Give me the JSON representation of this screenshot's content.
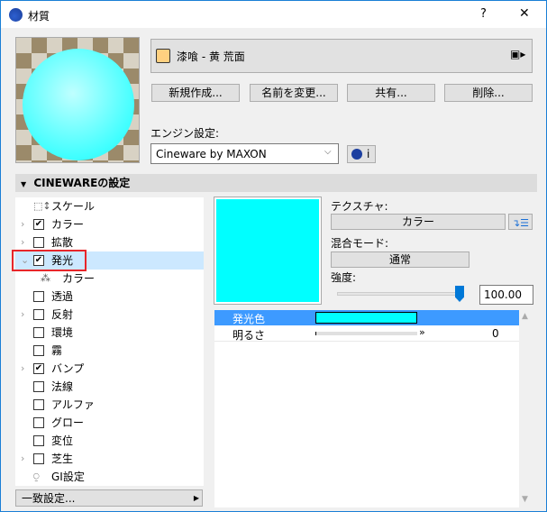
{
  "window": {
    "title": "材質",
    "help": "?",
    "close": "✕"
  },
  "material": {
    "name": "漆喰 - 黄 荒面",
    "swatch_color": "#ffd080"
  },
  "buttons": {
    "new": "新規作成...",
    "rename": "名前を変更...",
    "share": "共有...",
    "delete": "削除..."
  },
  "engine": {
    "label": "エンジン設定:",
    "value": "Cineware by MAXON",
    "info": "i"
  },
  "section": {
    "title": "CINEWAREの設定"
  },
  "tree": [
    {
      "label": "スケール",
      "check": null,
      "expand": "",
      "icon": "scale"
    },
    {
      "label": "カラー",
      "check": true,
      "expand": "›"
    },
    {
      "label": "拡散",
      "check": false,
      "expand": "›"
    },
    {
      "label": "発光",
      "check": true,
      "expand": "⌄",
      "selected": true
    },
    {
      "label": "カラー",
      "check": null,
      "expand": "",
      "icon": "channel",
      "child": true
    },
    {
      "label": "透過",
      "check": false,
      "expand": ""
    },
    {
      "label": "反射",
      "check": false,
      "expand": "›"
    },
    {
      "label": "環境",
      "check": false,
      "expand": ""
    },
    {
      "label": "霧",
      "check": false,
      "expand": ""
    },
    {
      "label": "バンプ",
      "check": true,
      "expand": "›"
    },
    {
      "label": "法線",
      "check": false,
      "expand": ""
    },
    {
      "label": "アルファ",
      "check": false,
      "expand": ""
    },
    {
      "label": "グロー",
      "check": false,
      "expand": ""
    },
    {
      "label": "変位",
      "check": false,
      "expand": ""
    },
    {
      "label": "芝生",
      "check": false,
      "expand": "›"
    },
    {
      "label": "GI設定",
      "check": null,
      "expand": "",
      "icon": "gi"
    }
  ],
  "match": {
    "label": "一致設定..."
  },
  "panel": {
    "texture_label": "テクスチャ:",
    "texture_value": "カラー",
    "blend_label": "混合モード:",
    "blend_value": "通常",
    "strength_label": "強度:",
    "strength_value": "100.00",
    "strength_fraction": 1.0,
    "preview_color": "#00ffff"
  },
  "params": [
    {
      "name": "発光色",
      "color": "#00ffff"
    },
    {
      "name": "明るさ",
      "value": "0",
      "fraction": 0
    }
  ]
}
